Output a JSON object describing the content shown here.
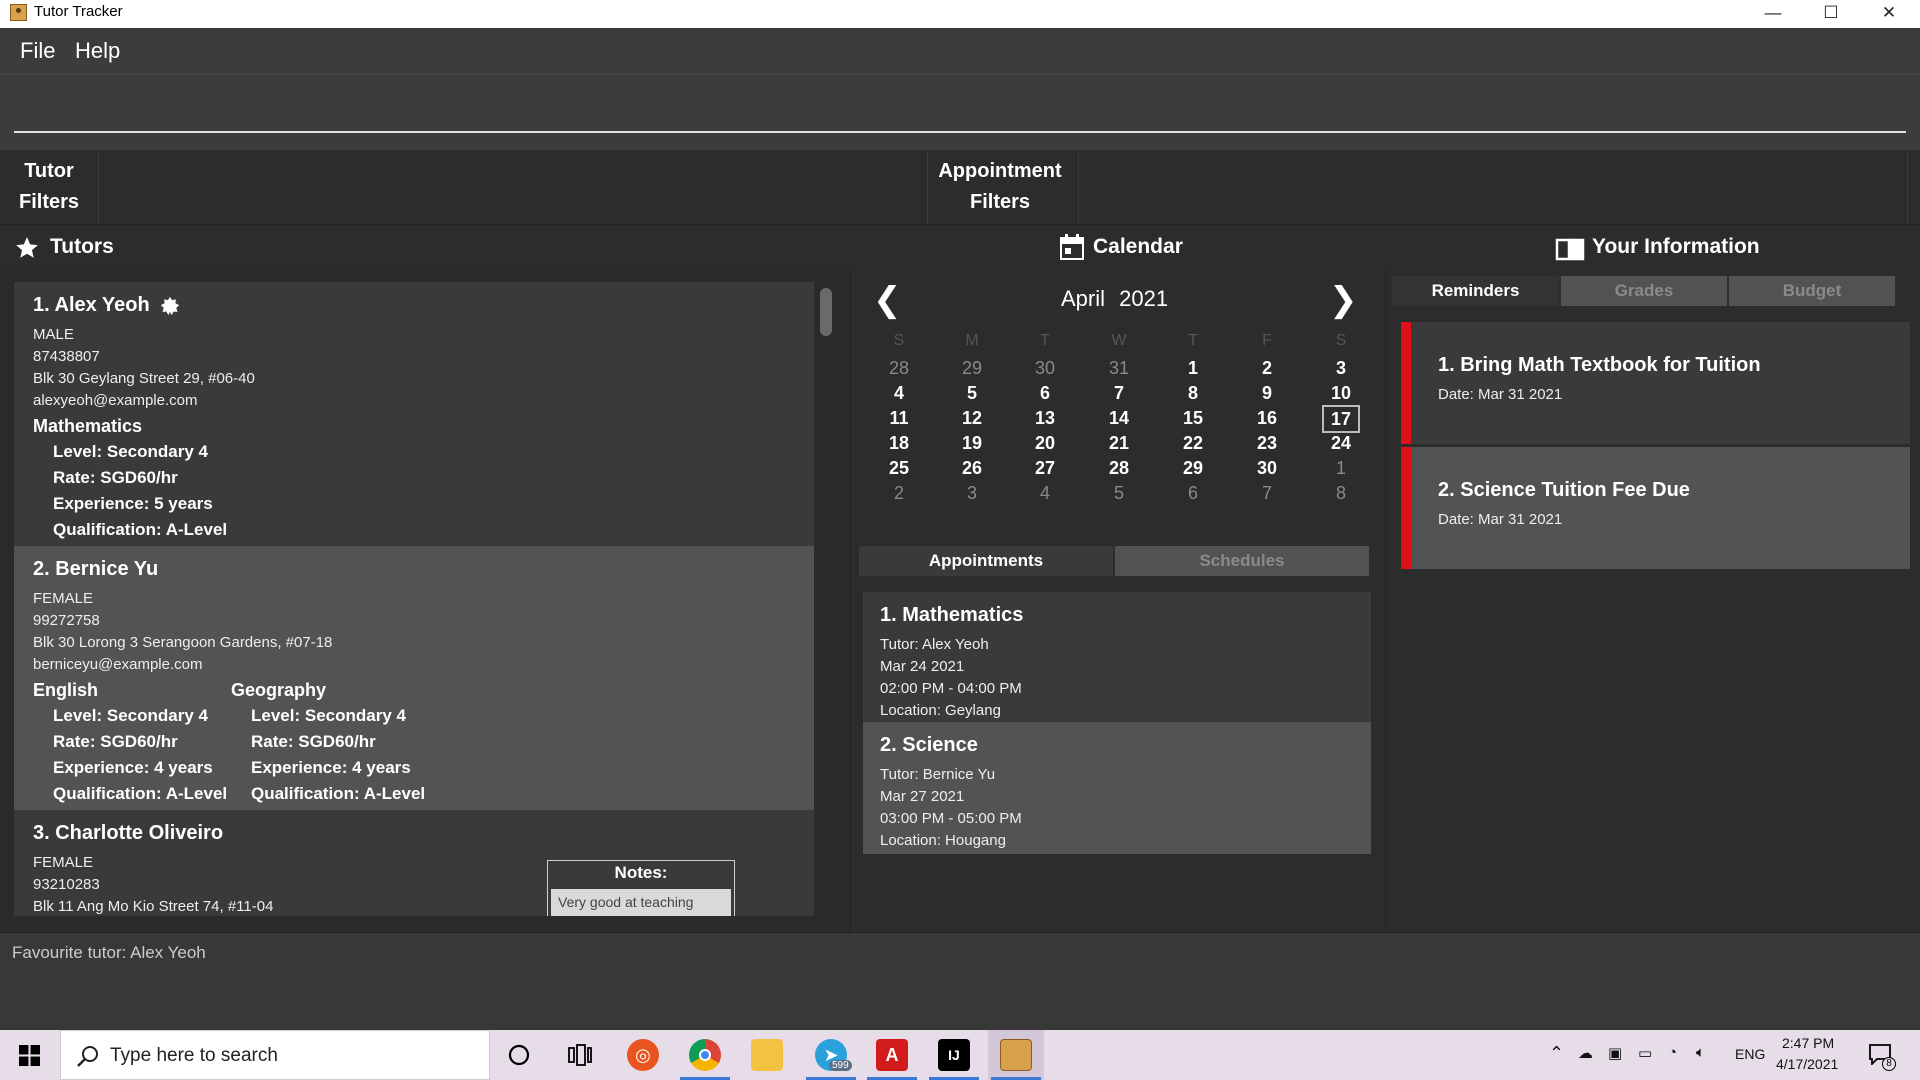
{
  "window": {
    "title": "Tutor Tracker",
    "minimize": "—",
    "maximize": "☐",
    "close": "✕"
  },
  "menu": {
    "file": "File",
    "help": "Help"
  },
  "command": {
    "value": ""
  },
  "filters": {
    "tutor_line1": "Tutor",
    "tutor_line2": "Filters",
    "appt_line1": "Appointment",
    "appt_line2": "Filters"
  },
  "headers": {
    "tutors": "Tutors",
    "calendar": "Calendar",
    "your_info": "Your Information"
  },
  "tutors": [
    {
      "name": "1.  Alex Yeoh",
      "gender": "MALE",
      "phone": "87438807",
      "address": "Blk 30 Geylang Street 29, #06-40",
      "email": "alexyeoh@example.com",
      "subjects": [
        {
          "name": "Mathematics",
          "level": "Level: Secondary 4",
          "rate": "Rate: SGD60/hr",
          "experience": "Experience: 5 years",
          "qualification": "Qualification: A-Level"
        }
      ]
    },
    {
      "name": "2.  Bernice Yu",
      "gender": "FEMALE",
      "phone": "99272758",
      "address": "Blk 30 Lorong 3 Serangoon Gardens, #07-18",
      "email": "berniceyu@example.com",
      "subjects": [
        {
          "name": "English",
          "level": "Level: Secondary 4",
          "rate": "Rate: SGD60/hr",
          "experience": "Experience: 4 years",
          "qualification": "Qualification: A-Level"
        },
        {
          "name": "Geography",
          "level": "Level: Secondary 4",
          "rate": "Rate: SGD60/hr",
          "experience": "Experience: 4 years",
          "qualification": "Qualification: A-Level"
        }
      ]
    },
    {
      "name": "3.  Charlotte Oliveiro",
      "gender": "FEMALE",
      "phone": "93210283",
      "address": "Blk 11 Ang Mo Kio Street 74, #11-04",
      "notes_title": "Notes:",
      "notes_body": "Very good at teaching English"
    }
  ],
  "calendar": {
    "month": "April",
    "year": "2021",
    "prev": "❮",
    "next": "❯",
    "dow": [
      "S",
      "M",
      "T",
      "W",
      "T",
      "F",
      "S"
    ],
    "weeks": [
      [
        "28",
        "29",
        "30",
        "31",
        "1",
        "2",
        "3"
      ],
      [
        "4",
        "5",
        "6",
        "7",
        "8",
        "9",
        "10"
      ],
      [
        "11",
        "12",
        "13",
        "14",
        "15",
        "16",
        "17"
      ],
      [
        "18",
        "19",
        "20",
        "21",
        "22",
        "23",
        "24"
      ],
      [
        "25",
        "26",
        "27",
        "28",
        "29",
        "30",
        "1"
      ],
      [
        "2",
        "3",
        "4",
        "5",
        "6",
        "7",
        "8"
      ]
    ],
    "today": "17"
  },
  "appt_tabs": {
    "appointments": "Appointments",
    "schedules": "Schedules"
  },
  "appointments": [
    {
      "title": "1.  Mathematics",
      "tutor": "Tutor: Alex Yeoh",
      "date": "Mar 24 2021",
      "time": "02:00 PM - 04:00 PM",
      "location": "Location: Geylang"
    },
    {
      "title": "2.  Science",
      "tutor": "Tutor: Bernice Yu",
      "date": "Mar 27 2021",
      "time": "03:00 PM - 05:00 PM",
      "location": "Location: Hougang"
    }
  ],
  "info_tabs": {
    "reminders": "Reminders",
    "grades": "Grades",
    "budget": "Budget"
  },
  "reminders": [
    {
      "title": "1.  Bring Math Textbook for Tuition",
      "date": "Date:  Mar 31 2021"
    },
    {
      "title": "2.  Science Tuition Fee Due",
      "date": "Date:  Mar 31 2021"
    }
  ],
  "status": {
    "text": "Favourite tutor: Alex Yeoh"
  },
  "taskbar": {
    "search_placeholder": "Type here to search",
    "telegram_badge": "599",
    "lang": "ENG",
    "time": "2:47 PM",
    "date": "4/17/2021",
    "notif_count": "8"
  },
  "colors": {
    "accent_red": "#e0101a",
    "panel_dark": "#2c2c2c",
    "card": "#3a3a3a",
    "card_selected": "#535353"
  }
}
